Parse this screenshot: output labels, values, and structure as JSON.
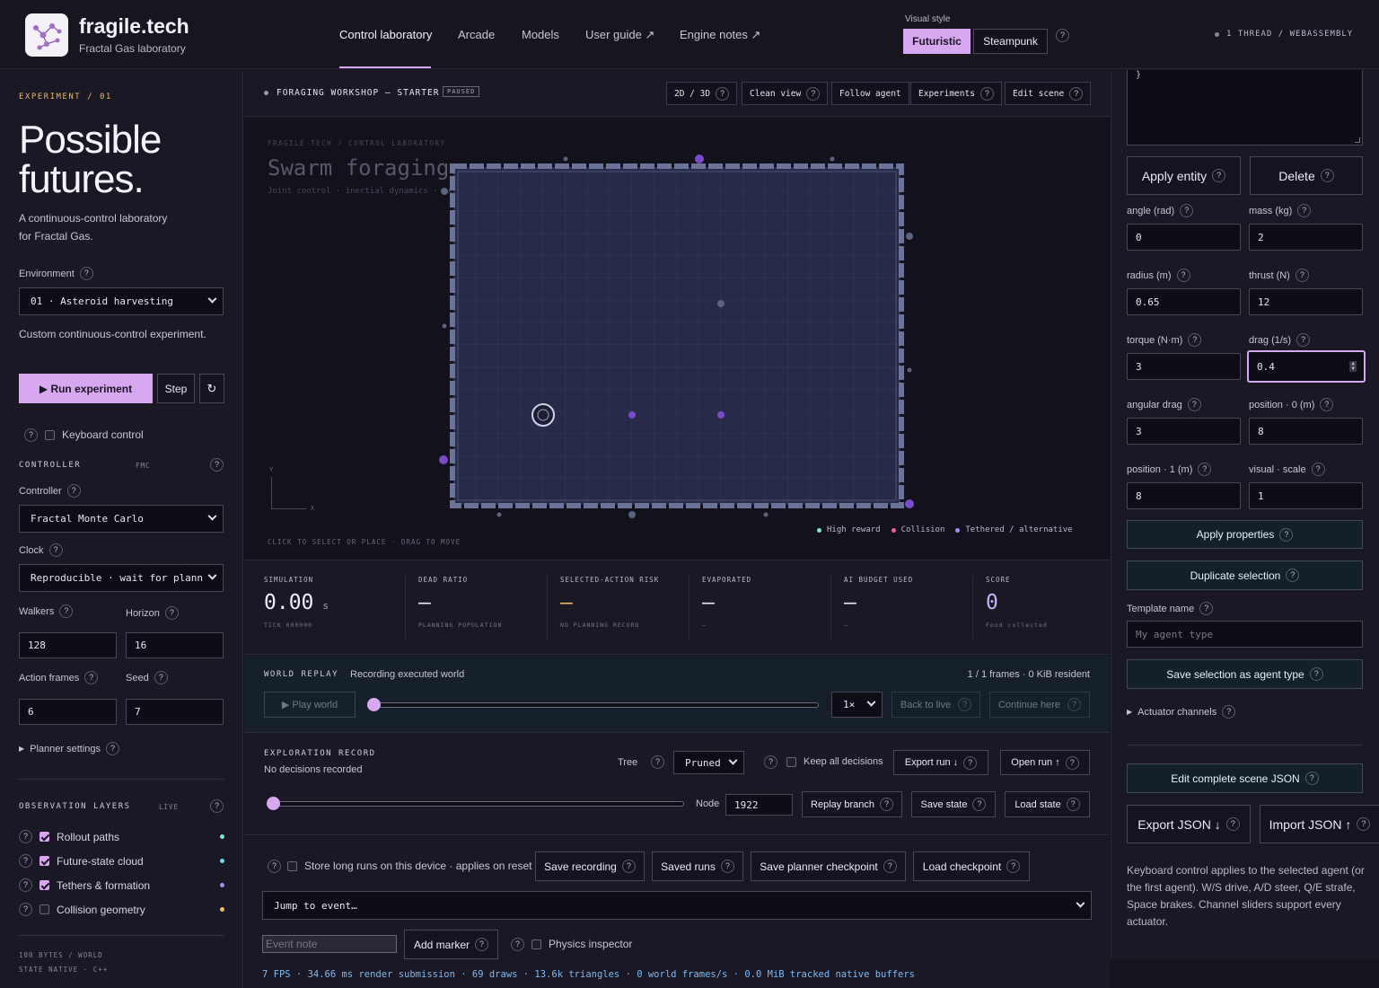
{
  "brand": {
    "name": "fragile.tech",
    "subtitle": "Fractal Gas laboratory"
  },
  "nav": [
    {
      "label": "Control laboratory"
    },
    {
      "label": "Arcade"
    },
    {
      "label": "Models"
    },
    {
      "label": "User guide ↗"
    },
    {
      "label": "Engine notes ↗"
    }
  ],
  "visual_style": {
    "label": "Visual style",
    "options": [
      "Futuristic",
      "Steampunk"
    ],
    "selected": "Futuristic"
  },
  "thread_info": "1 THREAD / WEBASSEMBLY",
  "left": {
    "experiment_tag": "EXPERIMENT / 01",
    "hero_line1": "Possible",
    "hero_line2": "futures.",
    "description_line1": "A continuous-control laboratory",
    "description_line2": "for Fractal Gas.",
    "environment_label": "Environment",
    "environment_value": "01 · Asteroid harvesting",
    "environment_note": "Custom continuous-control experiment.",
    "run_label": "▶ Run experiment",
    "step_label": "Step",
    "reset_icon": "↻",
    "keyboard_label": "Keyboard control",
    "controller_heading": "CONTROLLER",
    "controller_tag": "FMC",
    "controller_label": "Controller",
    "controller_value": "Fractal Monte Carlo",
    "clock_label": "Clock",
    "clock_value": "Reproducible · wait for plann",
    "walkers_label": "Walkers",
    "walkers_value": "128",
    "horizon_label": "Horizon",
    "horizon_value": "16",
    "action_frames_label": "Action frames",
    "action_frames_value": "6",
    "seed_label": "Seed",
    "seed_value": "7",
    "planner_settings": "Planner settings",
    "observation_heading": "OBSERVATION LAYERS",
    "observation_tag": "LIVE",
    "layers": [
      {
        "label": "Rollout paths",
        "checked": true,
        "color": "#7fe8c8"
      },
      {
        "label": "Future-state cloud",
        "checked": true,
        "color": "#6fd8e8"
      },
      {
        "label": "Tethers & formation",
        "checked": true,
        "color": "#a88ef0"
      },
      {
        "label": "Collision geometry",
        "checked": false,
        "color": "#f0c060"
      }
    ],
    "footer_line1": "100 BYTES / WORLD",
    "footer_line2": "STATE NATIVE · C++"
  },
  "center": {
    "scene_title": "FORAGING WORKSHOP — STARTER",
    "status_badge": "PAUSED",
    "toolbar": [
      "2D / 3D",
      "Clean view",
      "Follow agent",
      "Experiments",
      "Edit scene"
    ],
    "breadcrumb": "FRAGILE TECH / CONTROL LABORATORY",
    "canvas_title": "Swarm foraging",
    "canvas_subtitle": "Joint control · inertial dynamics · exact state replay",
    "axis_y": "Y",
    "axis_x": "X",
    "canvas_hint": "CLICK TO SELECT OR PLACE · DRAG TO MOVE",
    "legend": [
      {
        "label": "High reward",
        "color": "#7fe8c8"
      },
      {
        "label": "Collision",
        "color": "#f06090"
      },
      {
        "label": "Tethered / alternative",
        "color": "#a88ef0"
      }
    ],
    "stats": [
      {
        "label": "SIMULATION",
        "value": "0.00",
        "unit": "s",
        "sub": "TICK 000000",
        "color": "#f0ecfa"
      },
      {
        "label": "DEAD RATIO",
        "value": "—",
        "unit": "",
        "sub": "PLANNING POPULATION",
        "color": "#f0ecfa"
      },
      {
        "label": "SELECTED-ACTION RISK",
        "value": "—",
        "unit": "",
        "sub": "NO PLANNING RECORD",
        "color": "#f0c060"
      },
      {
        "label": "EVAPORATED",
        "value": "—",
        "unit": "",
        "sub": "—",
        "color": "#f0ecfa"
      },
      {
        "label": "AI BUDGET USED",
        "value": "—",
        "unit": "",
        "sub": "—",
        "color": "#f0ecfa"
      },
      {
        "label": "SCORE",
        "value": "0",
        "unit": "",
        "sub": "Food collected",
        "color": "#c8b0f8"
      }
    ],
    "replay": {
      "heading": "WORLD REPLAY",
      "status": "Recording executed world",
      "frames": "1 / 1 frames · 0 KiB resident",
      "play_label": "▶ Play world",
      "speed": "1×",
      "back_label": "Back to live",
      "continue_label": "Continue here",
      "progress": 0
    },
    "exploration": {
      "heading": "EXPLORATION RECORD",
      "status": "No decisions recorded",
      "tree_label": "Tree",
      "tree_value": "Pruned",
      "keep_label": "Keep all decisions",
      "export_label": "Export run ↓",
      "open_label": "Open run ↑",
      "node_label": "Node",
      "node_value": "1922",
      "replay_branch": "Replay branch",
      "save_state": "Save state",
      "load_state": "Load state",
      "progress": 0
    },
    "storage": {
      "store_label": "Store long runs on this device · applies on reset",
      "save_recording": "Save recording",
      "saved_runs": "Saved runs",
      "save_checkpoint": "Save planner checkpoint",
      "load_checkpoint": "Load checkpoint",
      "jump_placeholder": "Jump to event…",
      "event_note_placeholder": "Event note",
      "add_marker": "Add marker",
      "physics_label": "Physics inspector",
      "perf": "7 FPS · 34.66 ms render submission · 69 draws · 13.6k triangles · 0 world frames/s · 0.0 MiB tracked native buffers"
    }
  },
  "right": {
    "json_snippet": "}",
    "apply_entity": "Apply entity",
    "delete": "Delete",
    "props": [
      {
        "label": "angle (rad)",
        "value": "0"
      },
      {
        "label": "mass (kg)",
        "value": "2"
      },
      {
        "label": "radius (m)",
        "value": "0.65"
      },
      {
        "label": "thrust (N)",
        "value": "12"
      },
      {
        "label": "torque (N·m)",
        "value": "3"
      },
      {
        "label": "drag (1/s)",
        "value": "0.4"
      },
      {
        "label": "angular drag",
        "value": "3"
      },
      {
        "label": "position · 0 (m)",
        "value": "8"
      },
      {
        "label": "position · 1 (m)",
        "value": "8"
      },
      {
        "label": "visual · scale",
        "value": "1"
      }
    ],
    "apply_properties": "Apply properties",
    "duplicate_selection": "Duplicate selection",
    "template_label": "Template name",
    "template_placeholder": "My agent type",
    "save_agent_type": "Save selection as agent type",
    "actuator_channels": "Actuator channels",
    "edit_scene_json": "Edit complete scene JSON",
    "export_json": "Export JSON ↓",
    "import_json": "Import JSON ↑",
    "help_text": "Keyboard control applies to the selected agent (or the first agent). W/S drive, A/D steer, Q/E strafe, Space brakes. Channel sliders support every actuator."
  },
  "colors": {
    "accent": "#d7a8f0",
    "panel": "#1a1824",
    "canvas": "#13111c"
  }
}
